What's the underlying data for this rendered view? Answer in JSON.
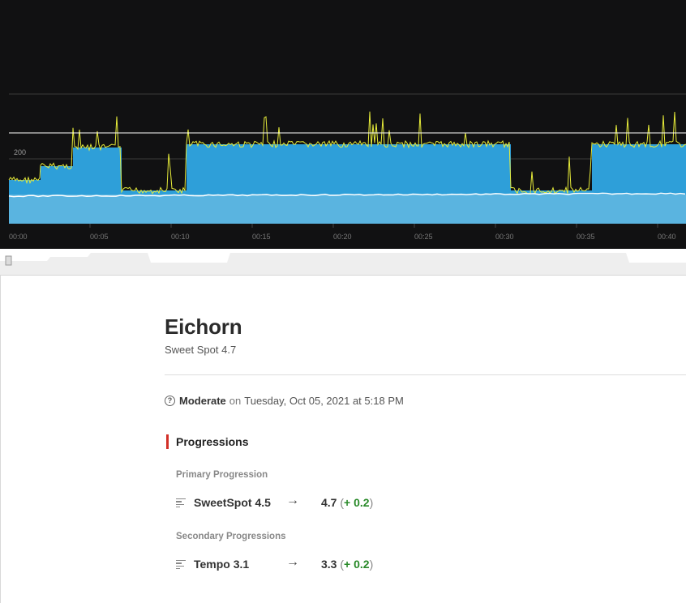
{
  "chart": {
    "y_tick_label": "200",
    "x_tick_labels": [
      "00:00",
      "00:05",
      "00:10",
      "00:15",
      "00:20",
      "00:25",
      "00:30",
      "00:35",
      "00:40"
    ],
    "colors": {
      "background": "#111112",
      "area_fill": "#2e9fd9",
      "power_line": "#e7ec3a",
      "heart_rate_line": "#ffffff",
      "gridline": "#3a3a3a"
    }
  },
  "workout": {
    "title": "Eichorn",
    "subtitle": "Sweet Spot 4.7",
    "difficulty": "Moderate",
    "on_word": "on",
    "date": "Tuesday, Oct 05, 2021 at 5:18 PM",
    "help_icon": "question-circle-icon"
  },
  "progressions": {
    "heading": "Progressions",
    "primary_label": "Primary Progression",
    "primary": {
      "name": "SweetSpot 4.5",
      "new_value": "4.7",
      "delta": "+ 0.2"
    },
    "secondary_label": "Secondary Progressions",
    "secondary": {
      "name": "Tempo 3.1",
      "new_value": "3.3",
      "delta": "+ 0.2"
    },
    "arrow": "→",
    "paren_open": "(",
    "paren_close": ")"
  }
}
